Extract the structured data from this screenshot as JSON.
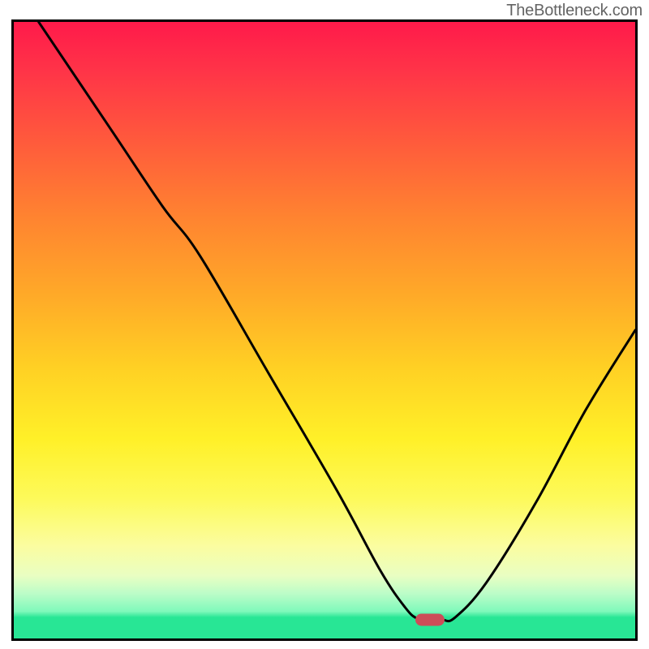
{
  "attribution": "TheBottleneck.com",
  "colors": {
    "border": "#000000",
    "gradient_top": "#ff1a4a",
    "gradient_bottom": "#28e695",
    "curve": "#000000",
    "marker": "#cd4d58"
  },
  "chart_data": {
    "type": "line",
    "title": "",
    "xlabel": "",
    "ylabel": "",
    "xlim": [
      0,
      100
    ],
    "ylim": [
      0,
      100
    ],
    "grid": false,
    "legend": false,
    "marker": {
      "x": 67,
      "y": 3
    },
    "curve_points": [
      {
        "x": 4,
        "y": 100
      },
      {
        "x": 16,
        "y": 82
      },
      {
        "x": 24,
        "y": 70
      },
      {
        "x": 30,
        "y": 62
      },
      {
        "x": 41,
        "y": 43
      },
      {
        "x": 52,
        "y": 24
      },
      {
        "x": 59,
        "y": 11
      },
      {
        "x": 63,
        "y": 5
      },
      {
        "x": 65,
        "y": 3.2
      },
      {
        "x": 67,
        "y": 3
      },
      {
        "x": 69,
        "y": 3
      },
      {
        "x": 71,
        "y": 3.4
      },
      {
        "x": 76,
        "y": 9
      },
      {
        "x": 84,
        "y": 22
      },
      {
        "x": 92,
        "y": 37
      },
      {
        "x": 100,
        "y": 50
      }
    ]
  }
}
